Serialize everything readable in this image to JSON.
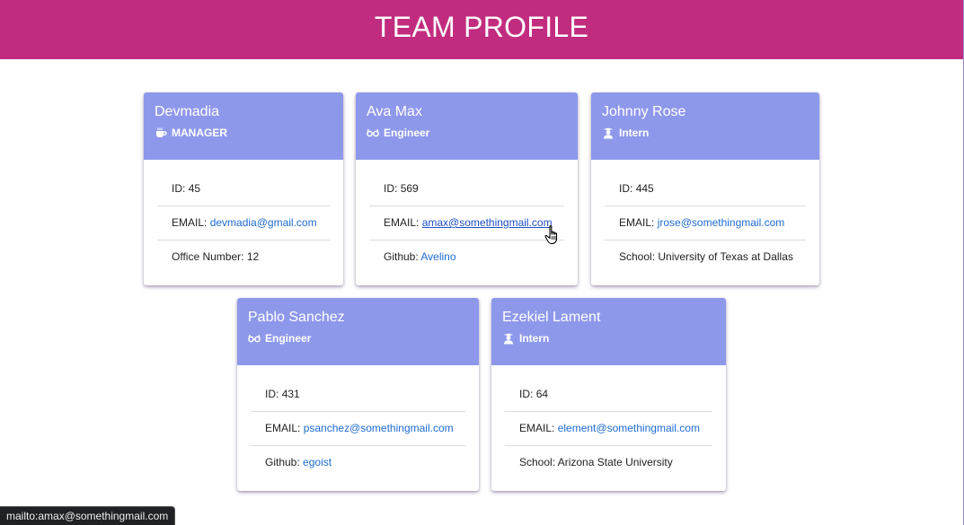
{
  "header": {
    "title": "TEAM PROFILE"
  },
  "colors": {
    "banner": "#c22c7f",
    "card_header": "#8e98eb",
    "link": "#1d6bd3"
  },
  "cards": [
    {
      "name": "Devmadia",
      "role": "MANAGER",
      "icon": "coffee-mug-icon",
      "rows": [
        {
          "label": "ID:",
          "value": "45"
        },
        {
          "label": "EMAIL:",
          "value": "devmadia@gmail.com"
        },
        {
          "label": "Office Number:",
          "value": "12"
        }
      ]
    },
    {
      "name": "Ava Max",
      "role": "Engineer",
      "icon": "glasses-icon",
      "rows": [
        {
          "label": "ID:",
          "value": "569"
        },
        {
          "label": "EMAIL:",
          "value": "amax@somethingmail.com"
        },
        {
          "label": "Github:",
          "value": "Avelino"
        }
      ]
    },
    {
      "name": "Johnny Rose",
      "role": "Intern",
      "icon": "graduate-icon",
      "rows": [
        {
          "label": "ID:",
          "value": "445"
        },
        {
          "label": "EMAIL:",
          "value": "jrose@somethingmail.com"
        },
        {
          "label": "School:",
          "value": "University of Texas at Dallas"
        }
      ]
    },
    {
      "name": "Pablo Sanchez",
      "role": "Engineer",
      "icon": "glasses-icon",
      "rows": [
        {
          "label": "ID:",
          "value": "431"
        },
        {
          "label": "EMAIL:",
          "value": "psanchez@somethingmail.com"
        },
        {
          "label": "Github:",
          "value": "egoist"
        }
      ]
    },
    {
      "name": "Ezekiel Lament",
      "role": "Intern",
      "icon": "graduate-icon",
      "rows": [
        {
          "label": "ID:",
          "value": "64"
        },
        {
          "label": "EMAIL:",
          "value": "element@somethingmail.com"
        },
        {
          "label": "School:",
          "value": "Arizona State University"
        }
      ]
    }
  ],
  "status_bar": {
    "text": "mailto:amax@somethingmail.com"
  }
}
